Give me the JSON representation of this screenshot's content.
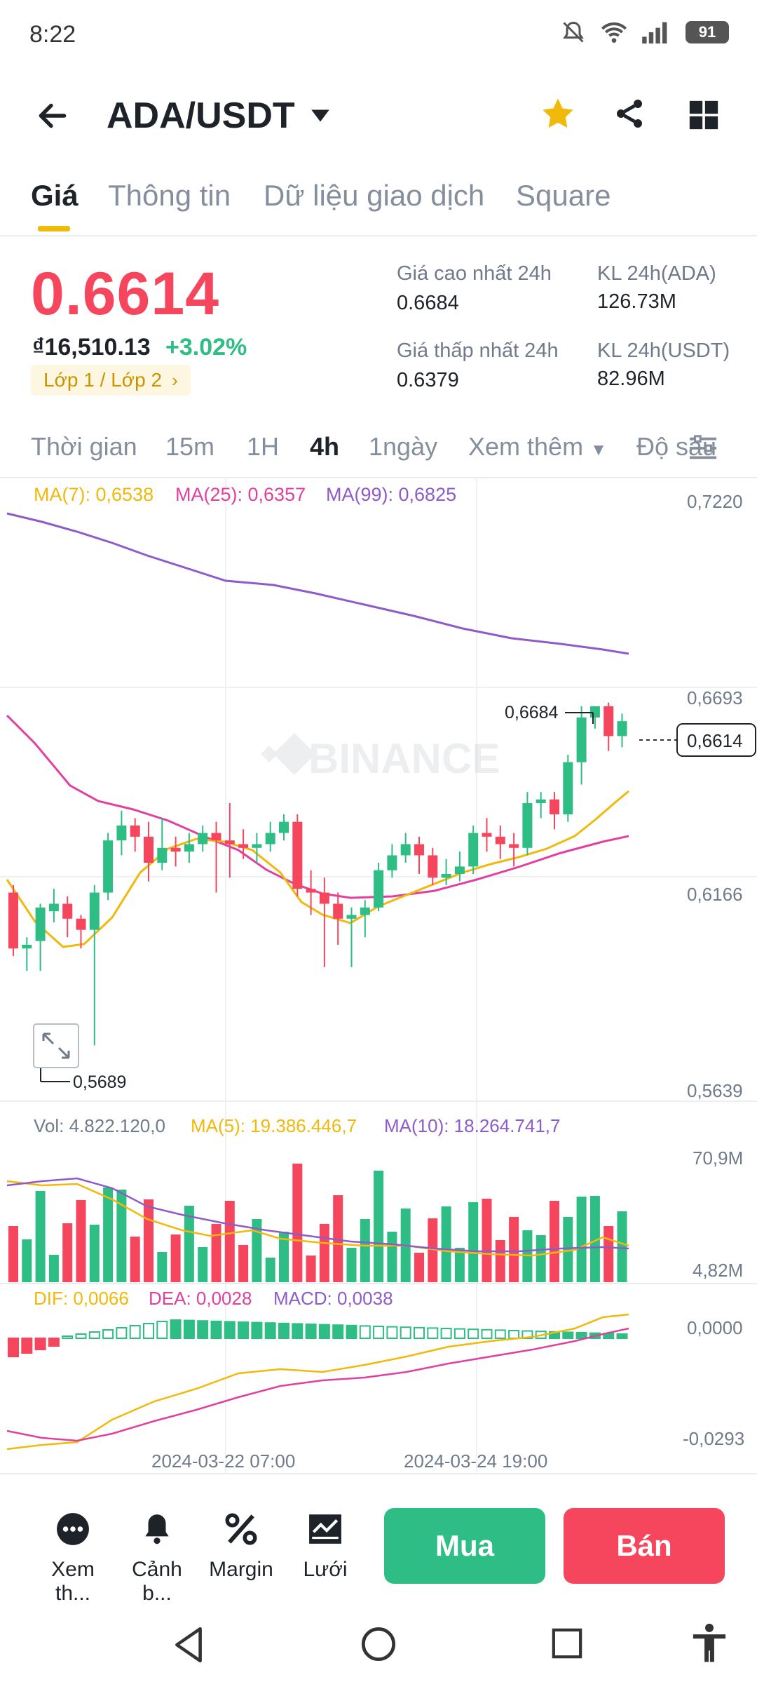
{
  "status": {
    "time": "8:22",
    "battery": "91"
  },
  "header": {
    "pair": "ADA/USDT"
  },
  "tabs": [
    "Giá",
    "Thông tin",
    "Dữ liệu giao dịch",
    "Square"
  ],
  "ticker": {
    "price": "0.6614",
    "fiat": "₫16,510.13",
    "change": "+3.02%",
    "layer_chip": "Lớp 1 / Lớp 2",
    "high_label": "Giá cao nhất 24h",
    "high": "0.6684",
    "low_label": "Giá thấp nhất 24h",
    "low": "0.6379",
    "vol_base_label": "KL 24h(ADA)",
    "vol_base": "126.73M",
    "vol_quote_label": "KL 24h(USDT)",
    "vol_quote": "82.96M"
  },
  "intervals": [
    "Thời gian",
    "15m",
    "1H",
    "4h",
    "1ngày",
    "Xem thêm",
    "Độ sâu"
  ],
  "chart": {
    "ma7": "MA(7): 0,6538",
    "ma25": "MA(25): 0,6357",
    "ma99": "MA(99): 0,6825",
    "watermark": "BINANCE",
    "y_labels": [
      "0,7220",
      "0,6693",
      "0,6166",
      "0,5639"
    ],
    "high_marker": "0,6684",
    "low_marker": "0,5689",
    "current": "0,6614",
    "vol_legend": "Vol: 4.822.120,0",
    "vol_ma5": "MA(5): 19.386.446,7",
    "vol_ma10": "MA(10): 18.264.741,7",
    "vol_y": [
      "70,9M",
      "4,82M"
    ],
    "dif": "DIF: 0,0066",
    "dea": "DEA: 0,0028",
    "macd": "MACD: 0,0038",
    "macd_y": [
      "0,0000",
      "-0,0293"
    ],
    "x_labels": [
      "2024-03-22 07:00",
      "2024-03-24 19:00"
    ]
  },
  "chart_data": {
    "type": "candlestick",
    "ylim": [
      0.5639,
      0.722
    ],
    "candles": [
      [
        0.618,
        0.603,
        0.601,
        0.62
      ],
      [
        0.603,
        0.604,
        0.597,
        0.606
      ],
      [
        0.605,
        0.614,
        0.597,
        0.615
      ],
      [
        0.613,
        0.615,
        0.61,
        0.619
      ],
      [
        0.615,
        0.611,
        0.606,
        0.617
      ],
      [
        0.611,
        0.608,
        0.603,
        0.612
      ],
      [
        0.608,
        0.618,
        0.577,
        0.62
      ],
      [
        0.618,
        0.632,
        0.616,
        0.634
      ],
      [
        0.632,
        0.636,
        0.628,
        0.64
      ],
      [
        0.636,
        0.633,
        0.629,
        0.638
      ],
      [
        0.633,
        0.626,
        0.621,
        0.637
      ],
      [
        0.626,
        0.63,
        0.624,
        0.638
      ],
      [
        0.63,
        0.629,
        0.625,
        0.633
      ],
      [
        0.629,
        0.631,
        0.626,
        0.634
      ],
      [
        0.631,
        0.634,
        0.629,
        0.636
      ],
      [
        0.634,
        0.632,
        0.618,
        0.637
      ],
      [
        0.632,
        0.631,
        0.622,
        0.642
      ],
      [
        0.631,
        0.63,
        0.627,
        0.635
      ],
      [
        0.63,
        0.631,
        0.626,
        0.634
      ],
      [
        0.631,
        0.634,
        0.629,
        0.637
      ],
      [
        0.634,
        0.637,
        0.632,
        0.639
      ],
      [
        0.637,
        0.619,
        0.617,
        0.639
      ],
      [
        0.619,
        0.618,
        0.612,
        0.624
      ],
      [
        0.618,
        0.615,
        0.598,
        0.622
      ],
      [
        0.615,
        0.611,
        0.604,
        0.618
      ],
      [
        0.611,
        0.612,
        0.598,
        0.614
      ],
      [
        0.612,
        0.614,
        0.606,
        0.616
      ],
      [
        0.614,
        0.624,
        0.613,
        0.626
      ],
      [
        0.624,
        0.628,
        0.622,
        0.631
      ],
      [
        0.628,
        0.631,
        0.626,
        0.634
      ],
      [
        0.631,
        0.628,
        0.623,
        0.633
      ],
      [
        0.628,
        0.622,
        0.62,
        0.63
      ],
      [
        0.622,
        0.623,
        0.62,
        0.627
      ],
      [
        0.623,
        0.625,
        0.621,
        0.629
      ],
      [
        0.625,
        0.634,
        0.623,
        0.636
      ],
      [
        0.634,
        0.633,
        0.629,
        0.638
      ],
      [
        0.633,
        0.631,
        0.627,
        0.636
      ],
      [
        0.631,
        0.63,
        0.625,
        0.634
      ],
      [
        0.63,
        0.642,
        0.628,
        0.645
      ],
      [
        0.642,
        0.643,
        0.638,
        0.645
      ],
      [
        0.643,
        0.639,
        0.635,
        0.645
      ],
      [
        0.639,
        0.653,
        0.637,
        0.655
      ],
      [
        0.653,
        0.665,
        0.647,
        0.668
      ],
      [
        0.665,
        0.668,
        0.662,
        0.668
      ],
      [
        0.668,
        0.66,
        0.656,
        0.669
      ],
      [
        0.66,
        0.664,
        0.657,
        0.666
      ]
    ]
  },
  "bottom": {
    "tools": [
      "Xem th...",
      "Cảnh b...",
      "Margin",
      "Lưới"
    ],
    "buy": "Mua",
    "sell": "Bán"
  },
  "colors": {
    "up": "#2ebd85",
    "down": "#f6465d",
    "accent": "#f0b90b",
    "ma7": "#f0b90b",
    "ma25": "#e040a0",
    "ma99": "#8e5cc8"
  }
}
